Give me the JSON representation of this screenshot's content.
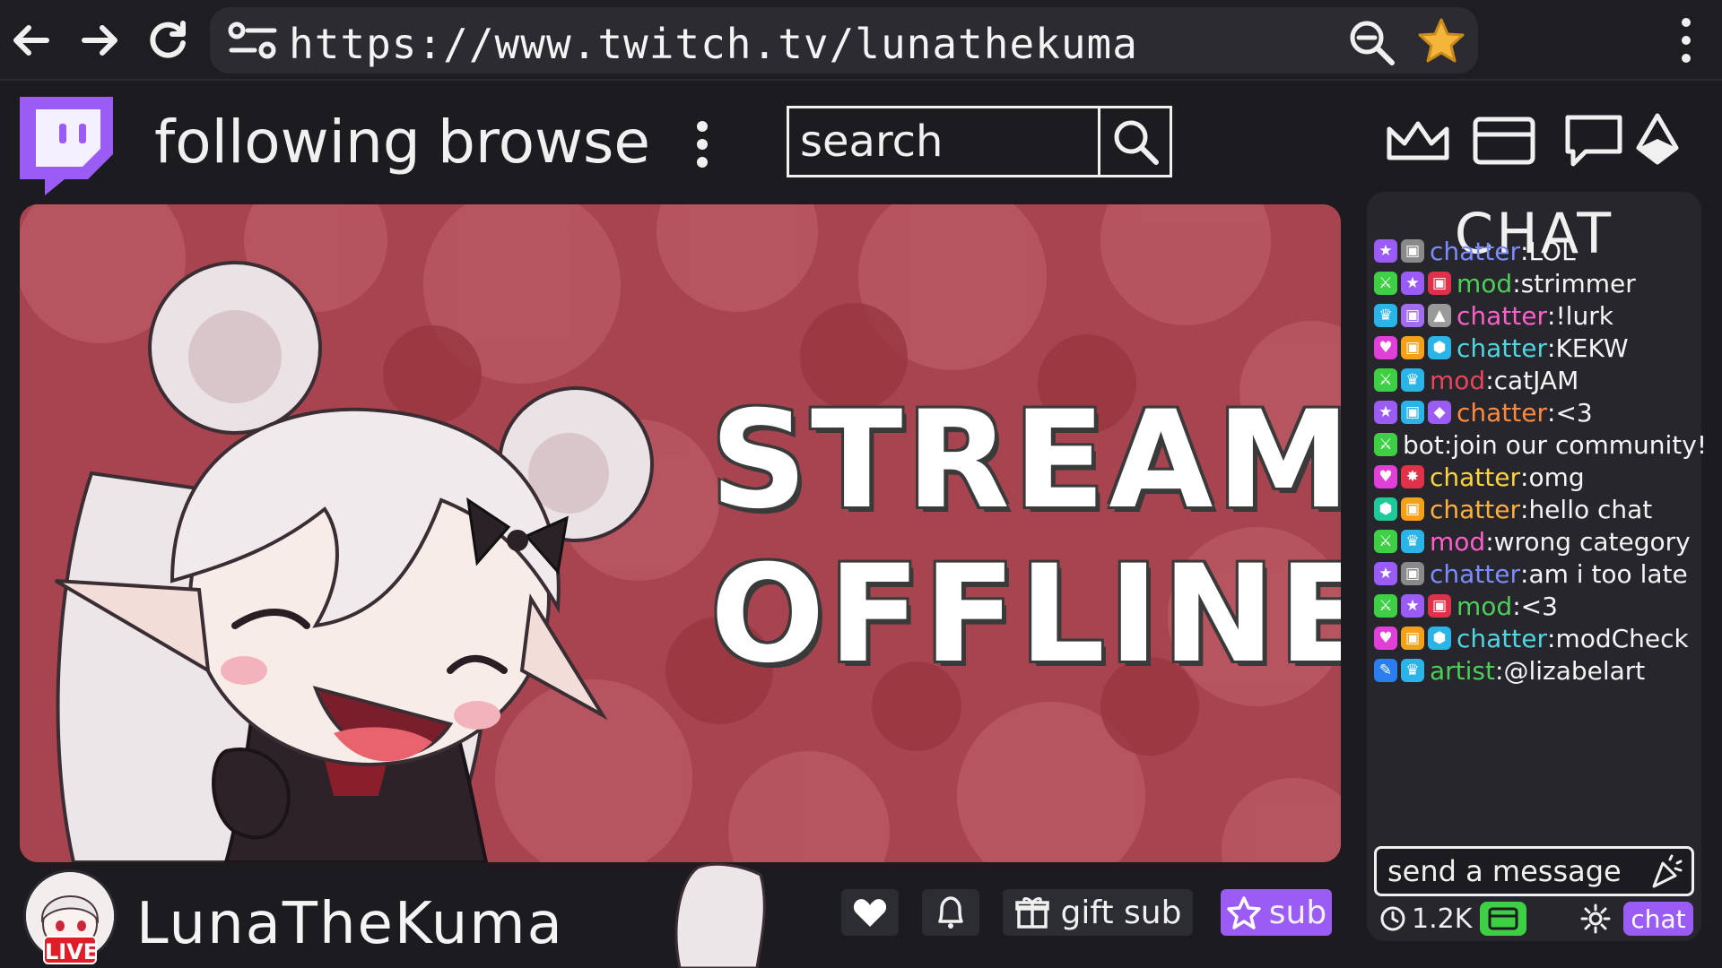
{
  "browser": {
    "url": "https://www.twitch.tv/lunathekuma"
  },
  "header": {
    "nav": [
      "following",
      "browse"
    ],
    "search_placeholder": "search"
  },
  "stream": {
    "status_line1": "STREAM",
    "status_line2": "OFFLINE"
  },
  "channel": {
    "name": "LunaTheKuma",
    "live_label": "LIVE",
    "gift_sub_label": "gift sub",
    "sub_label": "sub"
  },
  "chat": {
    "title": "CHAT",
    "messages": [
      {
        "user": "chatter",
        "color": "#7b8cff",
        "text": "LOL",
        "badges": [
          {
            "icon": "star-badge",
            "bg": "#9b5cf5"
          },
          {
            "icon": "gift-badge",
            "bg": "#8a8a8a"
          }
        ]
      },
      {
        "user": "mod",
        "color": "#4ccf57",
        "text": "strimmer",
        "badges": [
          {
            "icon": "sword-badge",
            "bg": "#3ecf44"
          },
          {
            "icon": "star-badge",
            "bg": "#9b5cf5"
          },
          {
            "icon": "gift-badge",
            "bg": "#e0314b"
          }
        ]
      },
      {
        "user": "chatter",
        "color": "#ff5fc8",
        "text": "!lurk",
        "badges": [
          {
            "icon": "crown-badge",
            "bg": "#2ab4e8"
          },
          {
            "icon": "gift-badge",
            "bg": "#a46cf0"
          },
          {
            "icon": "hill-badge",
            "bg": "#9a9a9a"
          }
        ]
      },
      {
        "user": "chatter",
        "color": "#4fd6e0",
        "text": "KEKW",
        "badges": [
          {
            "icon": "heart-badge",
            "bg": "#e040d8"
          },
          {
            "icon": "gift-badge",
            "bg": "#f4a11a"
          },
          {
            "icon": "hex-badge",
            "bg": "#2ab4e8"
          }
        ]
      },
      {
        "user": "mod",
        "color": "#e8455a",
        "text": "catJAM",
        "badges": [
          {
            "icon": "sword-badge",
            "bg": "#3ecf44"
          },
          {
            "icon": "crown-badge",
            "bg": "#2ab4e8"
          }
        ]
      },
      {
        "user": "chatter",
        "color": "#ff8a3d",
        "text": "<3",
        "badges": [
          {
            "icon": "star-badge",
            "bg": "#9b5cf5"
          },
          {
            "icon": "gift-badge",
            "bg": "#2ab4e8"
          },
          {
            "icon": "gem-badge",
            "bg": "#9b5cf5"
          }
        ]
      },
      {
        "user": "bot",
        "color": "#f4f4f4",
        "text": "join our community!",
        "badges": [
          {
            "icon": "sword-badge",
            "bg": "#3ecf44"
          }
        ]
      },
      {
        "user": "chatter",
        "color": "#ffd23f",
        "text": "omg",
        "badges": [
          {
            "icon": "heart-badge",
            "bg": "#e040d8"
          },
          {
            "icon": "burst-badge",
            "bg": "#e0314b"
          }
        ]
      },
      {
        "user": "chatter",
        "color": "#ffb03a",
        "text": "hello chat",
        "badges": [
          {
            "icon": "hex-badge",
            "bg": "#1fc99a"
          },
          {
            "icon": "gift-badge",
            "bg": "#f4a11a"
          }
        ]
      },
      {
        "user": "mod",
        "color": "#ff5fc8",
        "text": "wrong category",
        "badges": [
          {
            "icon": "sword-badge",
            "bg": "#3ecf44"
          },
          {
            "icon": "crown-badge",
            "bg": "#2ab4e8"
          }
        ]
      },
      {
        "user": "chatter",
        "color": "#7b8cff",
        "text": "am i too late",
        "badges": [
          {
            "icon": "star-badge",
            "bg": "#9b5cf5"
          },
          {
            "icon": "gift-badge",
            "bg": "#8a8a8a"
          }
        ]
      },
      {
        "user": "mod",
        "color": "#4ccf57",
        "text": "<3",
        "badges": [
          {
            "icon": "sword-badge",
            "bg": "#3ecf44"
          },
          {
            "icon": "star-badge",
            "bg": "#9b5cf5"
          },
          {
            "icon": "gift-badge",
            "bg": "#e0314b"
          }
        ]
      },
      {
        "user": "chatter",
        "color": "#4fd6e0",
        "text": "modCheck",
        "badges": [
          {
            "icon": "heart-badge",
            "bg": "#e040d8"
          },
          {
            "icon": "gift-badge",
            "bg": "#f4a11a"
          },
          {
            "icon": "hex-badge",
            "bg": "#2ab4e8"
          }
        ]
      },
      {
        "user": "artist",
        "color": "#4ccf57",
        "text": "@lizabelart",
        "badges": [
          {
            "icon": "brush-badge",
            "bg": "#2a7ef0"
          },
          {
            "icon": "crown-badge",
            "bg": "#2ab4e8"
          }
        ]
      }
    ],
    "input_placeholder": "send a message",
    "viewer_count": "1.2K",
    "chat_button": "chat"
  },
  "colors": {
    "twitch_purple": "#9b5cf5",
    "stream_bg": "#a8444f",
    "live_red": "#e01e2a",
    "bookmark_star": "#f4b63a"
  }
}
